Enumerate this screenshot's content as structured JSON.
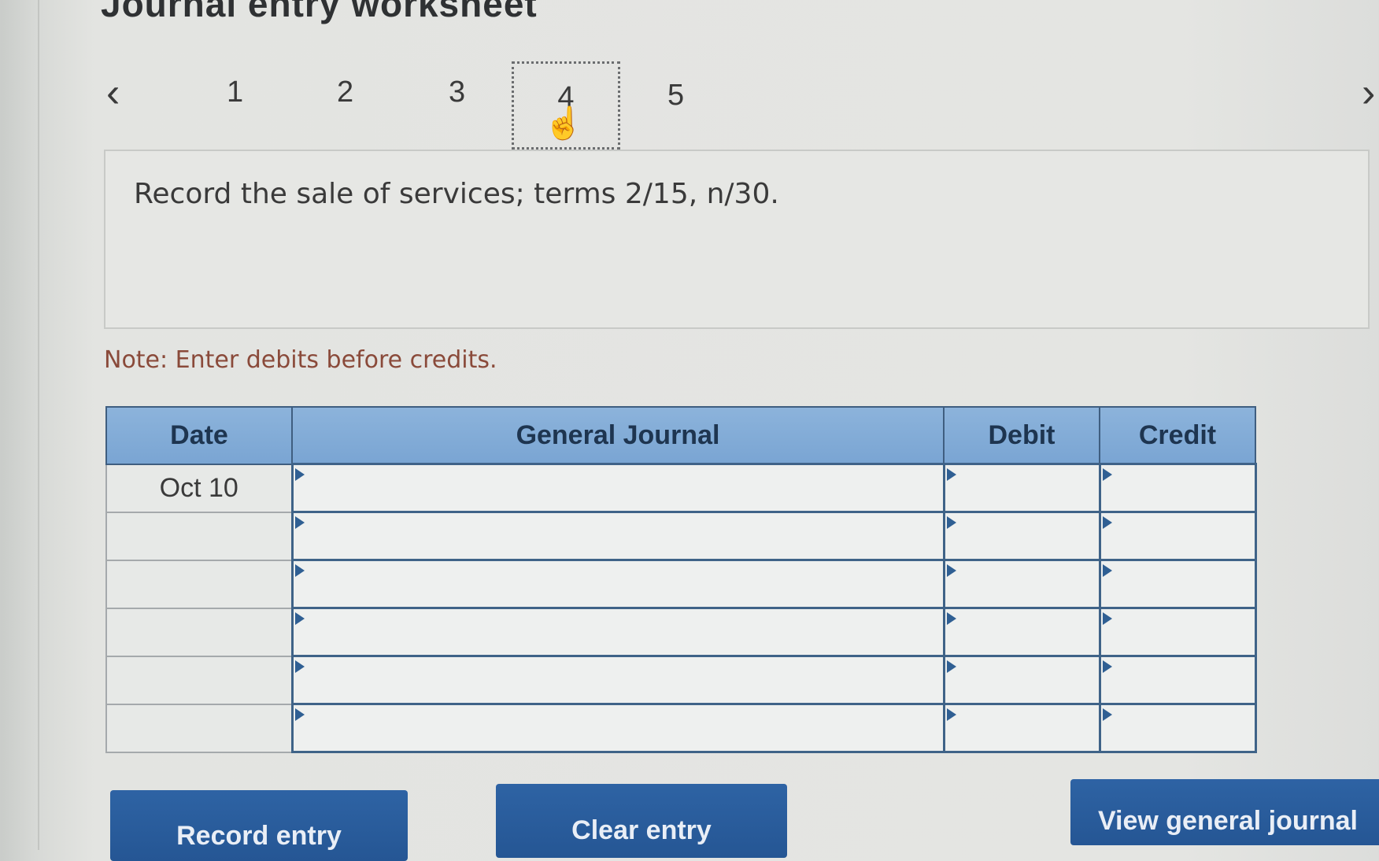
{
  "page": {
    "title": "Journal entry worksheet"
  },
  "step_nav": {
    "prev_icon": "chevron-left",
    "next_icon": "chevron-right",
    "steps": [
      "1",
      "2",
      "3",
      "4",
      "5"
    ],
    "active_step": "4"
  },
  "question": {
    "text": "Record the sale of services; terms 2/15, n/30."
  },
  "note": "Note: Enter debits before credits.",
  "journal": {
    "headers": {
      "date": "Date",
      "account": "General Journal",
      "debit": "Debit",
      "credit": "Credit"
    },
    "rows": [
      {
        "date": "Oct 10",
        "account": "",
        "debit": "",
        "credit": ""
      },
      {
        "date": "",
        "account": "",
        "debit": "",
        "credit": ""
      },
      {
        "date": "",
        "account": "",
        "debit": "",
        "credit": ""
      },
      {
        "date": "",
        "account": "",
        "debit": "",
        "credit": ""
      },
      {
        "date": "",
        "account": "",
        "debit": "",
        "credit": ""
      },
      {
        "date": "",
        "account": "",
        "debit": "",
        "credit": ""
      }
    ]
  },
  "buttons": {
    "record": "Record entry",
    "clear": "Clear entry",
    "view": "View general journal"
  },
  "colors": {
    "header_bg": "#7fa8d6",
    "button_bg": "#2a5c9c",
    "note_text": "#8a4a3a"
  }
}
